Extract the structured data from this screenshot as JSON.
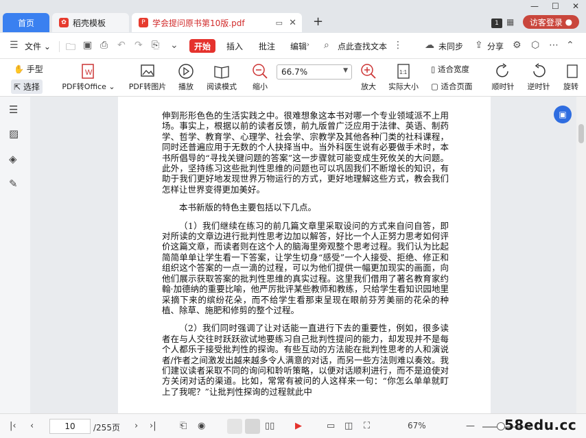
{
  "tabs": {
    "home": "首页",
    "templates": "稻壳模板",
    "pdf_file": "学会提问原书第10版.pdf"
  },
  "window": {
    "badge": "1",
    "login": "访客登录"
  },
  "menu": {
    "file": "文件",
    "start": "开始",
    "insert": "插入",
    "annotate": "批注",
    "edit": "编辑",
    "find_text": "点此查找文本",
    "sync": "未同步",
    "share": "分享"
  },
  "ribbon": {
    "hand": "手型",
    "select": "选择",
    "pdf_to_office": "PDF转Office",
    "pdf_to_image": "PDF转图片",
    "play": "播放",
    "read_mode": "阅读模式",
    "zoom_out": "缩小",
    "zoom_value": "66.7%",
    "zoom_in": "放大",
    "actual_size": "实际大小",
    "fit_width": "适合宽度",
    "fit_page": "适合页面",
    "rotate_cw": "顺时针",
    "rotate_ccw": "逆时针",
    "rotate": "旋转"
  },
  "doc": {
    "p1": "伸到形形色色的生活实践之中。很难想象这本书对哪一个专业领域派不上用场。事实上，根据以前的读者反馈，前九版曾广泛应用于法律、英语、制药学、哲学、教育学、心理学、社会学、宗教学及其他各种门类的社科课程，同时还普遍应用于无数的个人抉择当中。当外科医生说有必要做手术时，本书所倡导的“寻找关键问题的答案”这一步骤就可能变成生死攸关的大问题。此外，坚持练习这些批判性思维的问题也可以巩固我们不断增长的知识，有助于我们更好地发现世界万物运行的方式，更好地理解这些方式，教会我们怎样让世界变得更加美好。",
    "p2": "本书新版的特色主要包括以下几点。",
    "p3": "（1）我们继续在练习的前几篇文章里采取设问的方式来自问自答，即对所读的文章边进行批判性思考边加以解答，好比一个人正努力思考如何评价这篇文章，而读者则在这个人的脑海里旁观整个思考过程。我们认为比起简简单单让学生看一下答案，让学生切身“感受”一个人接受、拒绝、修正和组织这个答案的一点一滴的过程，可以为他们提供一幅更加现实的画面，向他们展示获取答案的批判性思维的真实过程。这里我们借用了著名教育家约翰·加德纳的重要比喻，他严厉批评某些教师和教练，只给学生看知识园地里采摘下来的缤纷花朵，而不给学生看那束呈现在眼前芬芳美丽的花朵的种植、除草、施肥和修剪的整个过程。",
    "p4": "（2）我们同时强调了让对话能一直进行下去的重要性，例如，很多读者在与人交往时跃跃欲试地要练习自己批判性提问的能力，却发现并不是每个人都乐于接受批判性的探询。有些互动的方法能在批判性思考的人和演说者/作者之间激发出越来越多令人满意的对话，而另一些方法则难以奏效。我们建议读者采取不同的询问和聆听策略，以便对话顺利进行，而不是迫使对方关闭对话的渠道。比如，常常有被问的人这样来一句：“你怎么单单就盯上了我呢？”让批判性探询的过程就此中"
  },
  "status": {
    "page": "10",
    "total": "/255页",
    "zoom": "67%"
  },
  "watermark": "58edu.cc"
}
